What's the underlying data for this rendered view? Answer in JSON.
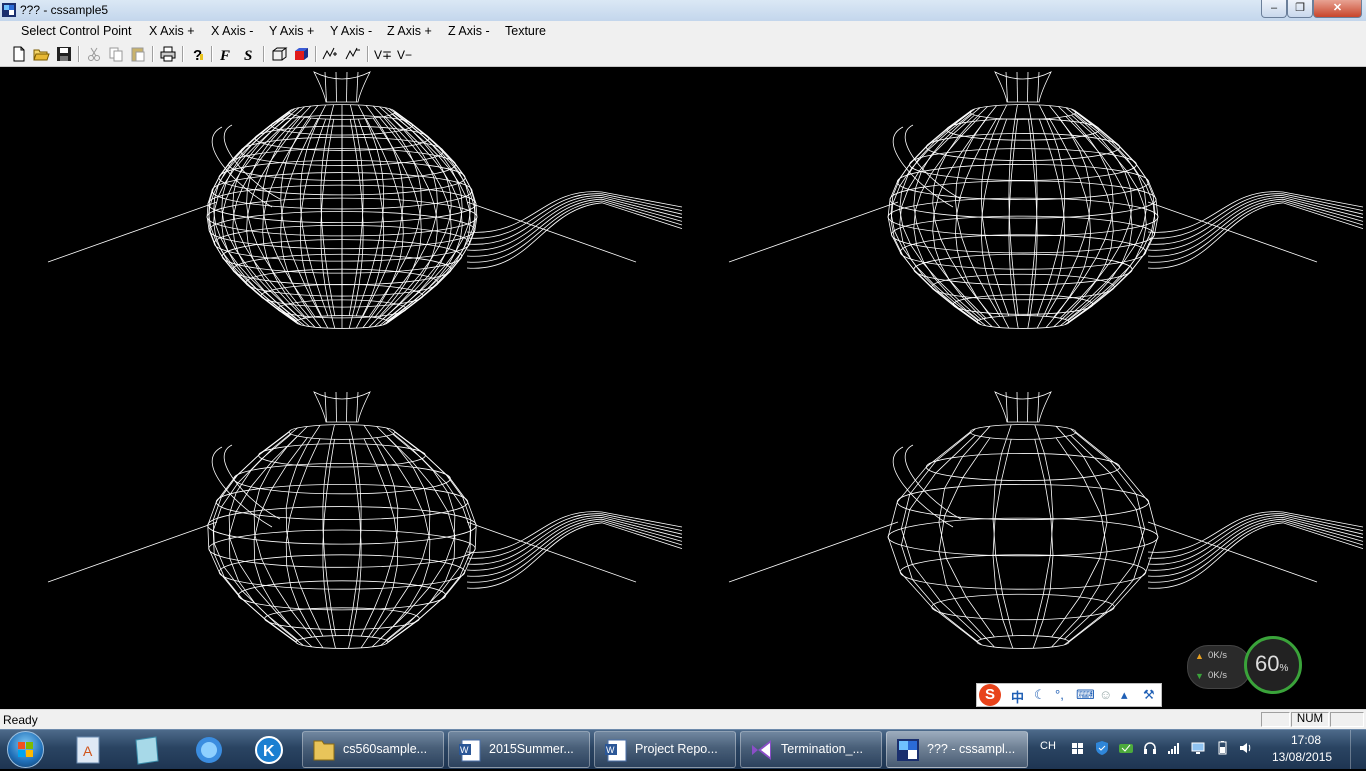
{
  "window": {
    "title": "??? - cssample5",
    "app_icon": "cssample-app-icon",
    "minimize_icon": "minimize-icon",
    "maximize_icon": "maximize-icon",
    "close_icon": "close-icon"
  },
  "menu": [
    "Select Control Point",
    "X Axis +",
    "X Axis -",
    "Y Axis +",
    "Y Axis -",
    "Z Axis +",
    "Z Axis -",
    "Texture"
  ],
  "toolbar": {
    "icons": [
      "new-document-icon",
      "open-folder-icon",
      "save-icon",
      "cut-icon",
      "copy-icon",
      "paste-icon",
      "print-icon",
      "help-icon",
      "f-icon",
      "s-icon",
      "wire-cube-icon",
      "solid-cube-icon",
      "subdivide-up-icon",
      "subdivide-down-icon",
      "vertex-plus-icon",
      "vertex-minus-icon"
    ],
    "letters": {
      "f": "F",
      "s": "S",
      "v_plus": "V∓",
      "v_minus": "V−"
    }
  },
  "viewport": {
    "background": "#000000",
    "wire_color": "#ffffff",
    "views": [
      {
        "name": "teapot-view-top-left",
        "mesh_density": "finest"
      },
      {
        "name": "teapot-view-top-right",
        "mesh_density": "fine"
      },
      {
        "name": "teapot-view-bottom-left",
        "mesh_density": "medium"
      },
      {
        "name": "teapot-view-bottom-right",
        "mesh_density": "coarse"
      }
    ]
  },
  "ime_bar": {
    "logo": "S",
    "mode": "中",
    "icons": [
      "moon-icon",
      "punctuation-icon",
      "keyboard-icon",
      "user-icon",
      "shirt-icon",
      "wrench-icon"
    ]
  },
  "net_monitor": {
    "upload": "0K/s",
    "download": "0K/s",
    "percent_value": "60",
    "percent_sign": "%",
    "accent": "#3aa33a"
  },
  "status": {
    "text": "Ready",
    "num": "NUM"
  },
  "taskbar": {
    "start_icon": "windows-start-orb",
    "pinned": [
      "text-editor-icon",
      "notes-icon",
      "internet-explorer-icon",
      "k-app-icon"
    ],
    "tasks": [
      {
        "label": "cs560sample...",
        "icon": "folder-icon"
      },
      {
        "label": "2015Summer...",
        "icon": "word-document-icon"
      },
      {
        "label": "Project Repo...",
        "icon": "word-document-icon"
      },
      {
        "label": "Termination_...",
        "icon": "visual-studio-icon"
      },
      {
        "label": "??? - cssampl...",
        "icon": "cssample-app-icon",
        "active": true
      }
    ],
    "language": "CH",
    "tray_icons": [
      "windows-flag-icon",
      "shield-icon",
      "security-icon",
      "headset-icon",
      "network-signal-icon",
      "display-icon",
      "battery-icon",
      "volume-icon"
    ],
    "clock": {
      "time": "17:08",
      "date": "13/08/2015"
    }
  }
}
